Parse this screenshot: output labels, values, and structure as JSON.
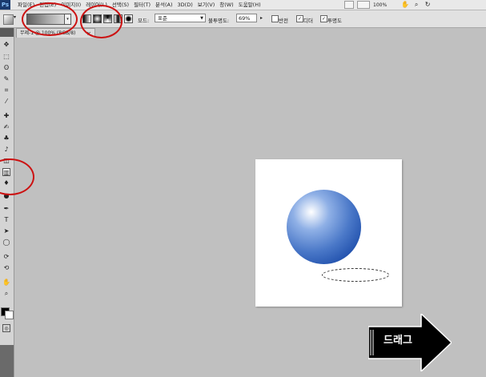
{
  "app": {
    "logo": "Ps"
  },
  "menubar": {
    "items": [
      "파일(E)",
      "편집(E)",
      "이미지(I)",
      "레이어(L)",
      "선택(S)",
      "필터(T)",
      "분석(A)",
      "3D(D)",
      "보기(V)",
      "창(W)",
      "도움말(H)"
    ],
    "zoom": "100%"
  },
  "options_bar": {
    "mode_label": "모드:",
    "mode_value": "표준",
    "opacity_label": "불투명도:",
    "opacity_value": "69%",
    "reverse_label": "반전",
    "reverse_checked": false,
    "dither_label": "디더",
    "dither_checked": true,
    "transparency_label": "투명도",
    "transparency_checked": true
  },
  "document": {
    "tab_title": "무제-1 @ 100% (RGB/8)",
    "close_glyph": "×"
  },
  "colors": {
    "foreground": "#000000",
    "background": "#ffffff",
    "annotation": "#cc1111",
    "sphere": "#1a4aa8"
  },
  "toolbox": {
    "tools": [
      {
        "name": "move-icon",
        "glyph": "✥"
      },
      {
        "name": "marquee-icon",
        "glyph": "⬚"
      },
      {
        "name": "lasso-icon",
        "glyph": "ʘ"
      },
      {
        "name": "quick-select-icon",
        "glyph": "✎"
      },
      {
        "name": "crop-icon",
        "glyph": "⌗"
      },
      {
        "name": "eyedropper-icon",
        "glyph": "⁄"
      },
      {
        "name": "healing-brush-icon",
        "glyph": "✚"
      },
      {
        "name": "brush-icon",
        "glyph": "✍"
      },
      {
        "name": "clone-stamp-icon",
        "glyph": "♣"
      },
      {
        "name": "history-brush-icon",
        "glyph": "♪"
      },
      {
        "name": "eraser-icon",
        "glyph": "◫"
      },
      {
        "name": "gradient-icon",
        "glyph": "▥"
      },
      {
        "name": "blur-icon",
        "glyph": "♦"
      },
      {
        "name": "dodge-icon",
        "glyph": "●"
      },
      {
        "name": "pen-icon",
        "glyph": "✒"
      },
      {
        "name": "type-icon",
        "glyph": "T"
      },
      {
        "name": "path-select-icon",
        "glyph": "➤"
      },
      {
        "name": "shape-icon",
        "glyph": "◯"
      },
      {
        "name": "3d-rotate-icon",
        "glyph": "⟳"
      },
      {
        "name": "3d-camera-icon",
        "glyph": "⟲"
      },
      {
        "name": "hand-icon",
        "glyph": "✋"
      },
      {
        "name": "zoom-icon",
        "glyph": "⌕"
      }
    ]
  },
  "overlay": {
    "drag_label": "드래그"
  }
}
